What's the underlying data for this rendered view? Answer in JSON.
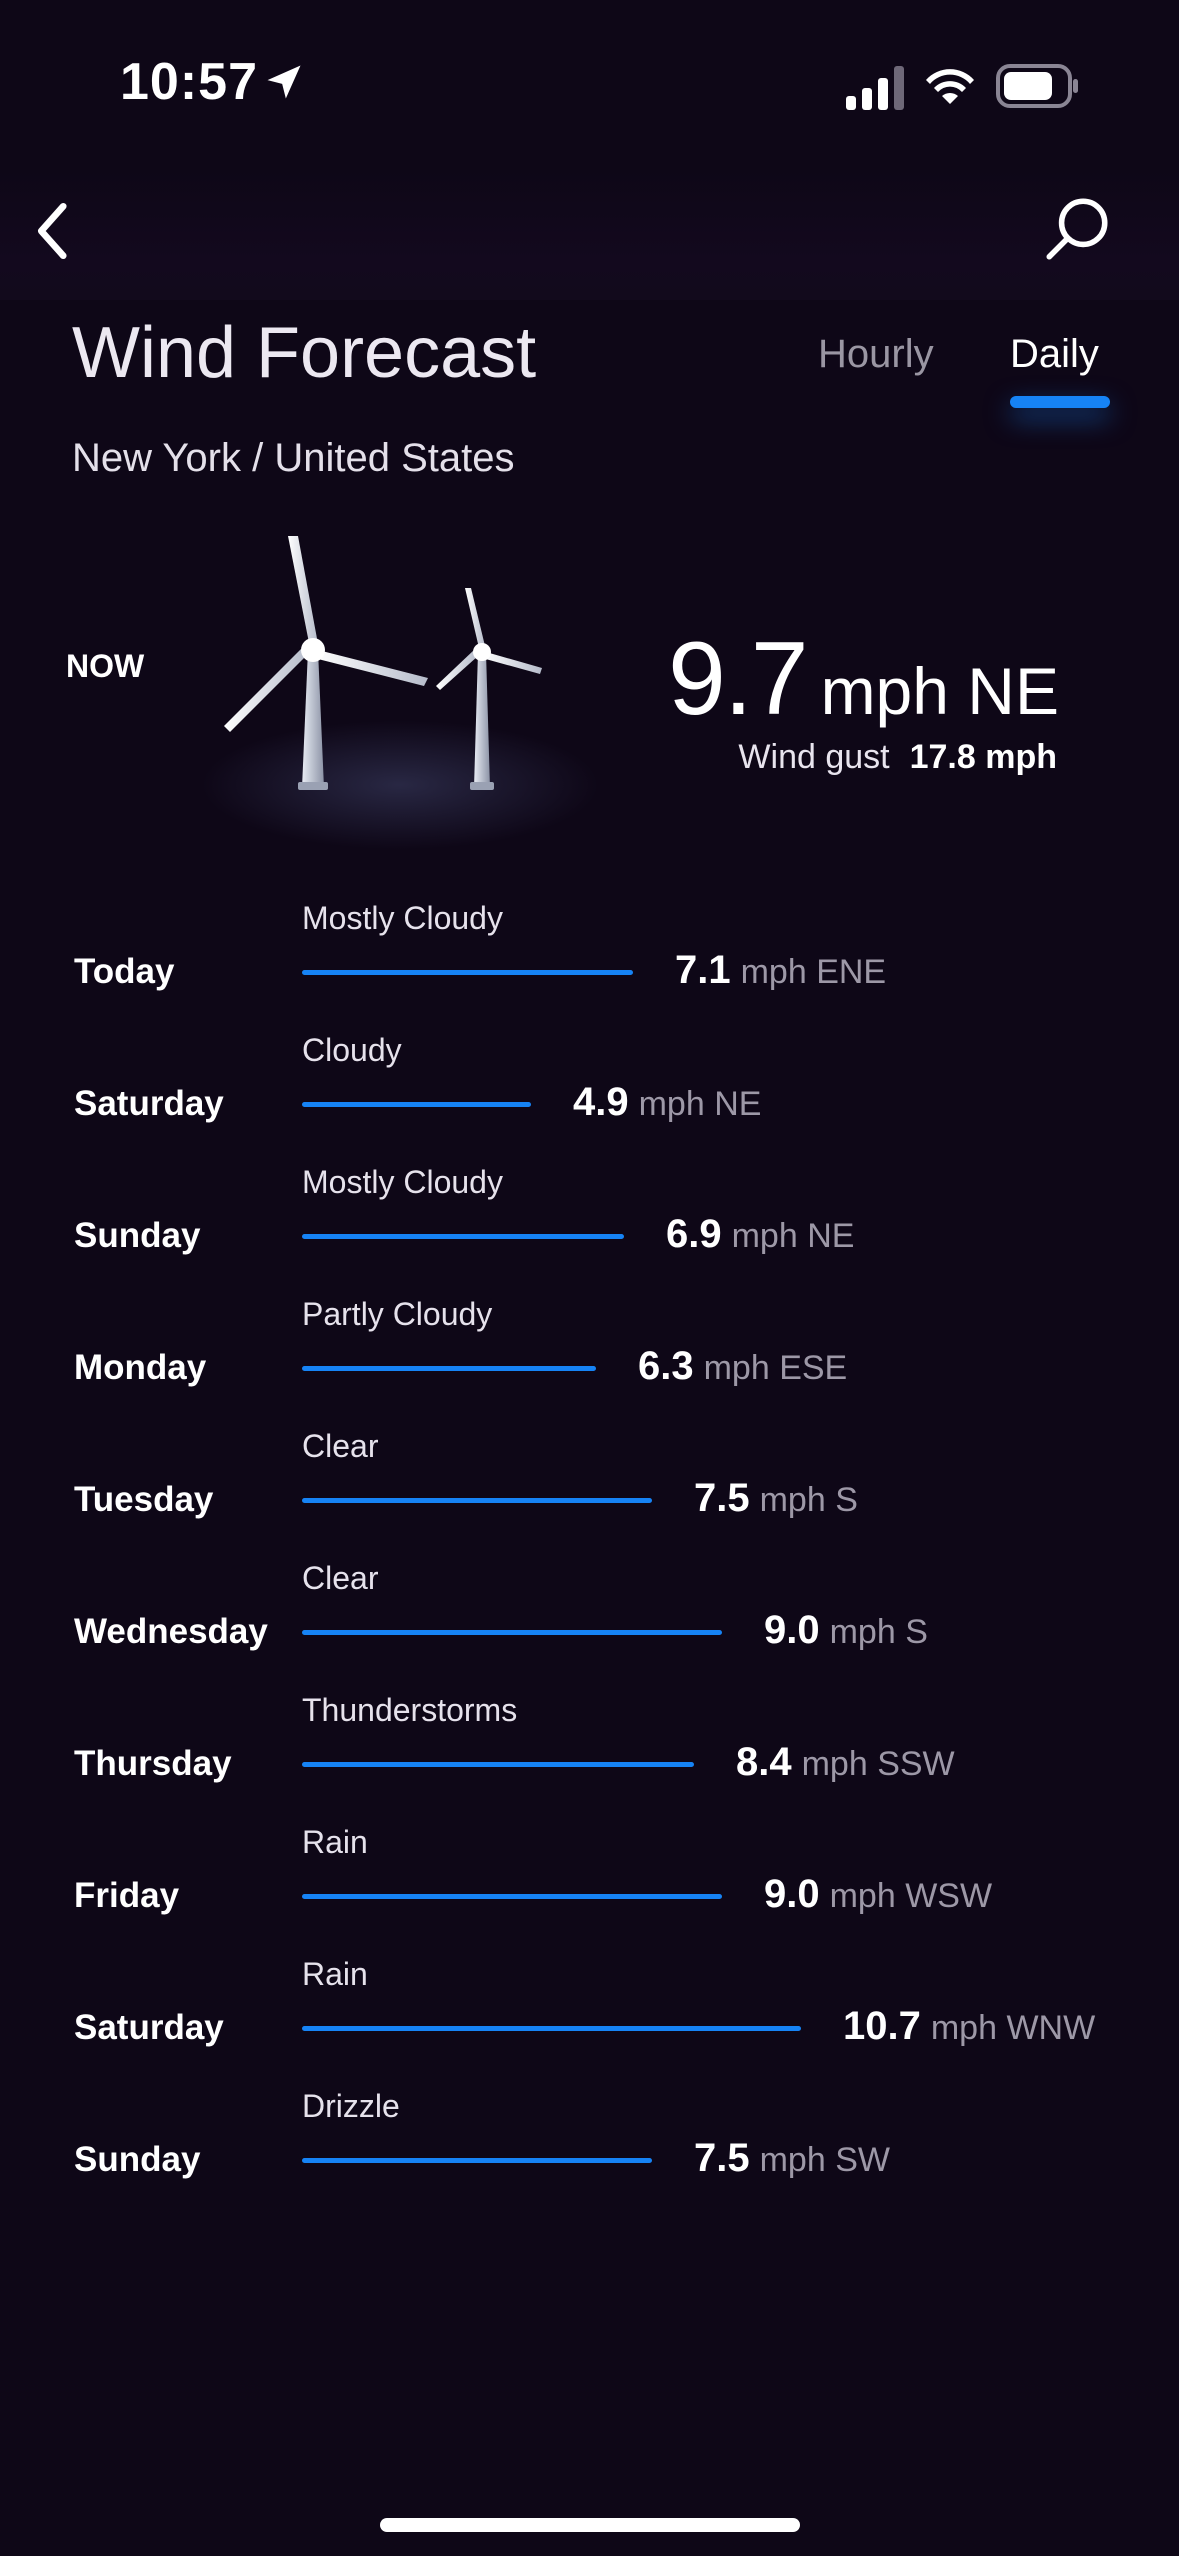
{
  "status_bar": {
    "time": "10:57",
    "icons": [
      "location-arrow-icon",
      "cellular-signal-icon",
      "wifi-icon",
      "battery-icon"
    ]
  },
  "nav": {
    "back_icon": "chevron-left-icon",
    "search_icon": "search-icon"
  },
  "header": {
    "title": "Wind Forecast",
    "tabs": [
      {
        "label": "Hourly",
        "active": false
      },
      {
        "label": "Daily",
        "active": true
      }
    ],
    "location": "New York / United States"
  },
  "current": {
    "label": "NOW",
    "speed": "9.7",
    "unit_direction": "mph NE",
    "gust_label": "Wind gust",
    "gust_value": "17.8 mph"
  },
  "colors": {
    "background": "#0e0717",
    "accent": "#1683f5",
    "muted_text": "#9d98a7"
  },
  "days": [
    {
      "day": "Today",
      "condition": "Mostly Cloudy",
      "speed": "7.1",
      "unit_dir": "mph ENE",
      "speed_mph": 7.1
    },
    {
      "day": "Saturday",
      "condition": "Cloudy",
      "speed": "4.9",
      "unit_dir": "mph NE",
      "speed_mph": 4.9
    },
    {
      "day": "Sunday",
      "condition": "Mostly Cloudy",
      "speed": "6.9",
      "unit_dir": "mph NE",
      "speed_mph": 6.9
    },
    {
      "day": "Monday",
      "condition": "Partly Cloudy",
      "speed": "6.3",
      "unit_dir": "mph ESE",
      "speed_mph": 6.3
    },
    {
      "day": "Tuesday",
      "condition": "Clear",
      "speed": "7.5",
      "unit_dir": "mph S",
      "speed_mph": 7.5
    },
    {
      "day": "Wednesday",
      "condition": "Clear",
      "speed": "9.0",
      "unit_dir": "mph S",
      "speed_mph": 9.0
    },
    {
      "day": "Thursday",
      "condition": "Thunderstorms",
      "speed": "8.4",
      "unit_dir": "mph SSW",
      "speed_mph": 8.4
    },
    {
      "day": "Friday",
      "condition": "Rain",
      "speed": "9.0",
      "unit_dir": "mph WSW",
      "speed_mph": 9.0
    },
    {
      "day": "Saturday",
      "condition": "Rain",
      "speed": "10.7",
      "unit_dir": "mph WNW",
      "speed_mph": 10.7
    },
    {
      "day": "Sunday",
      "condition": "Drizzle",
      "speed": "7.5",
      "unit_dir": "mph SW",
      "speed_mph": 7.5
    }
  ]
}
